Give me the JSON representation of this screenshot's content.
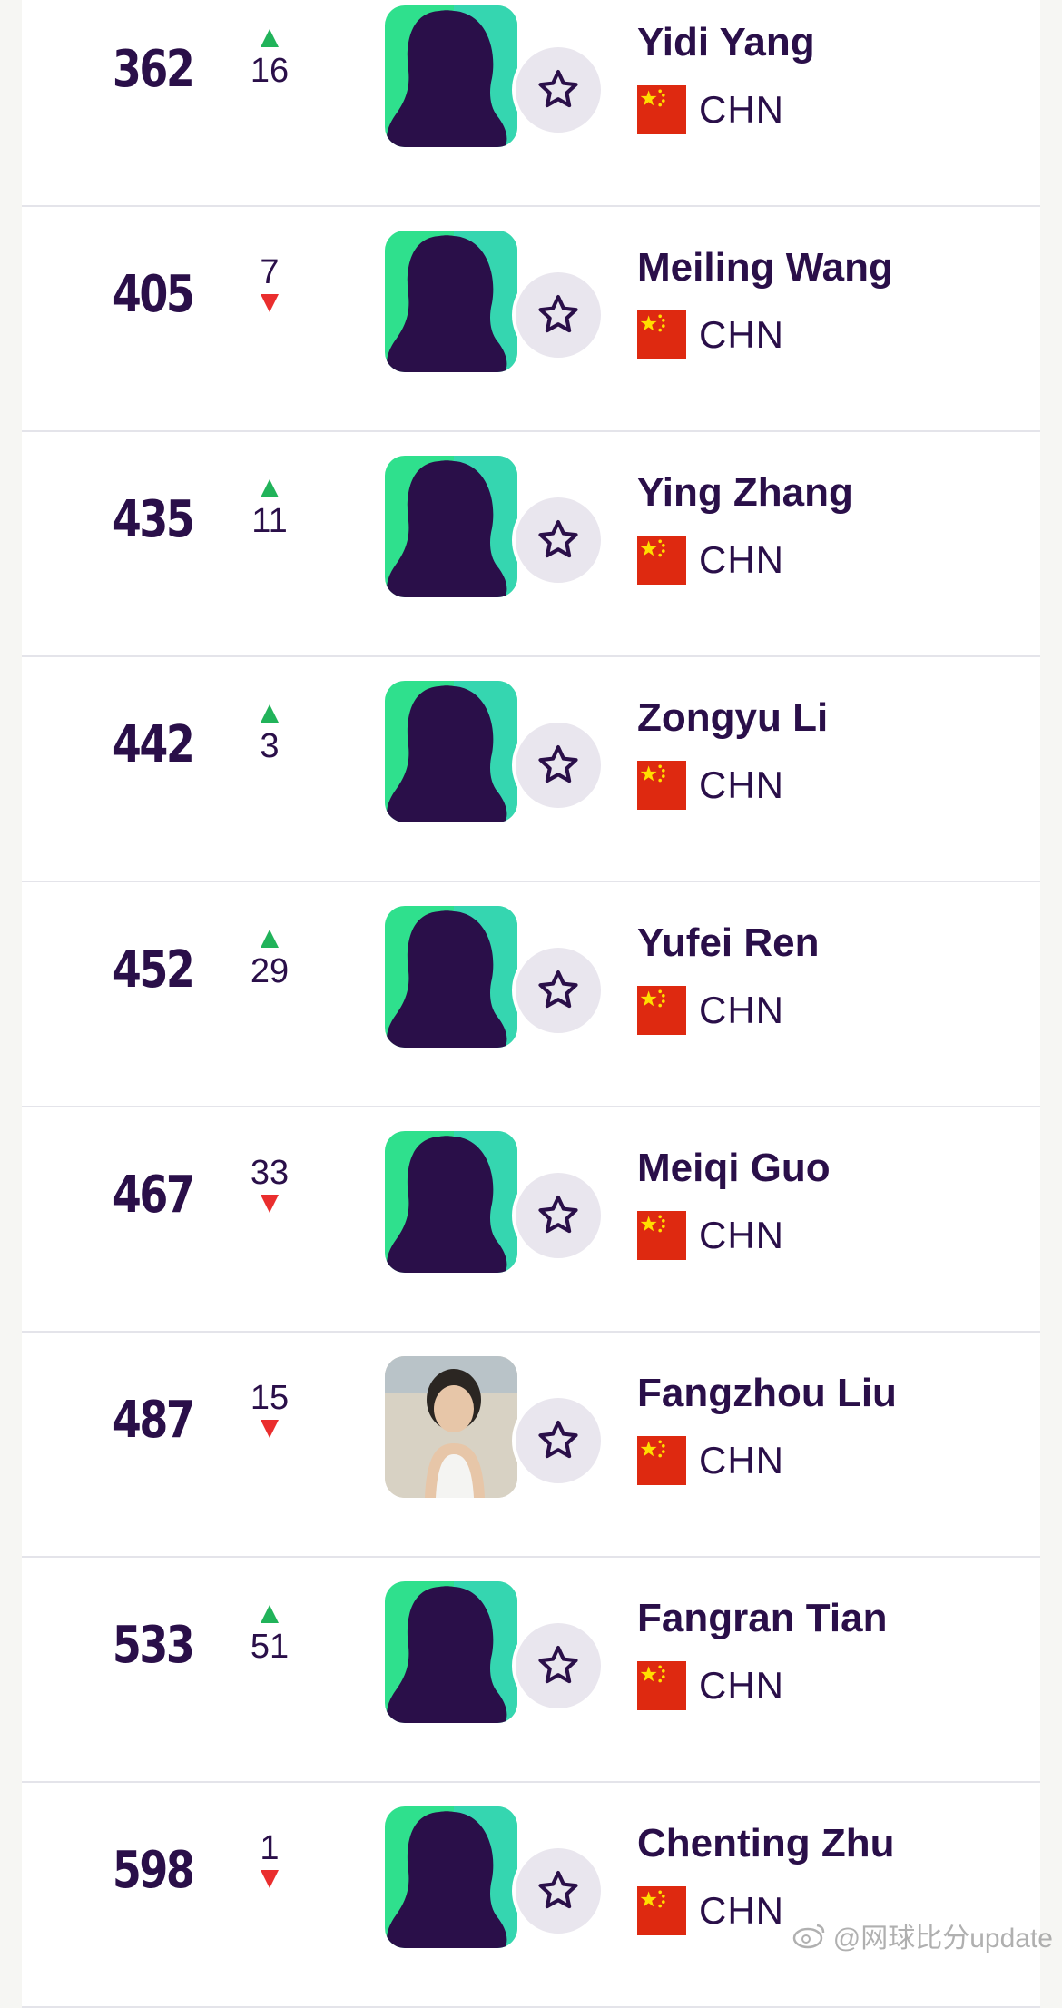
{
  "colors": {
    "up": "#21b35a",
    "down": "#ea2e2e",
    "text": "#2a0f49",
    "avatar_green": "#2fe08d"
  },
  "players": [
    {
      "rank": "362",
      "move": "16",
      "direction": "up",
      "name": "Yidi Yang",
      "country": "CHN",
      "avatar": "silhouette"
    },
    {
      "rank": "405",
      "move": "7",
      "direction": "down",
      "name": "Meiling Wang",
      "country": "CHN",
      "avatar": "silhouette"
    },
    {
      "rank": "435",
      "move": "11",
      "direction": "up",
      "name": "Ying Zhang",
      "country": "CHN",
      "avatar": "silhouette"
    },
    {
      "rank": "442",
      "move": "3",
      "direction": "up",
      "name": "Zongyu Li",
      "country": "CHN",
      "avatar": "silhouette"
    },
    {
      "rank": "452",
      "move": "29",
      "direction": "up",
      "name": "Yufei Ren",
      "country": "CHN",
      "avatar": "silhouette"
    },
    {
      "rank": "467",
      "move": "33",
      "direction": "down",
      "name": "Meiqi Guo",
      "country": "CHN",
      "avatar": "silhouette"
    },
    {
      "rank": "487",
      "move": "15",
      "direction": "down",
      "name": "Fangzhou Liu",
      "country": "CHN",
      "avatar": "photo"
    },
    {
      "rank": "533",
      "move": "51",
      "direction": "up",
      "name": "Fangran Tian",
      "country": "CHN",
      "avatar": "silhouette"
    },
    {
      "rank": "598",
      "move": "1",
      "direction": "down",
      "name": "Chenting Zhu",
      "country": "CHN",
      "avatar": "silhouette"
    }
  ],
  "icons": {
    "favorite": "star-outline-icon",
    "flag": "china-flag-icon"
  },
  "watermark": "@网球比分update"
}
